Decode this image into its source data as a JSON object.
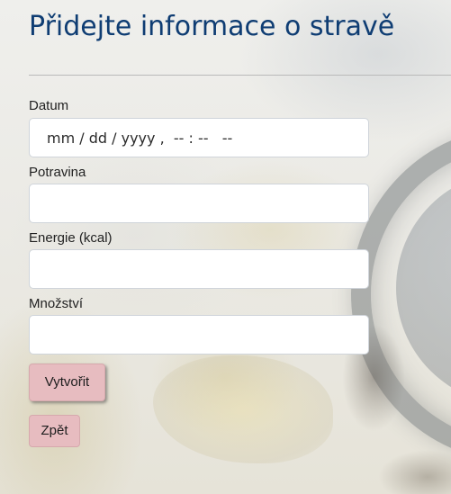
{
  "page": {
    "title": "Přidejte informace o stravě"
  },
  "form": {
    "date": {
      "label": "Datum",
      "display": "mm / dd / yyyy ,  -- : --   --"
    },
    "food": {
      "label": "Potravina",
      "value": ""
    },
    "energy": {
      "label": "Energie (kcal)",
      "value": ""
    },
    "amount": {
      "label": "Množství",
      "value": ""
    }
  },
  "buttons": {
    "create_label": "Vytvořit",
    "back_label": "Zpět"
  },
  "colors": {
    "title": "#0f3d73",
    "button_bg": "#e7bcc0"
  }
}
